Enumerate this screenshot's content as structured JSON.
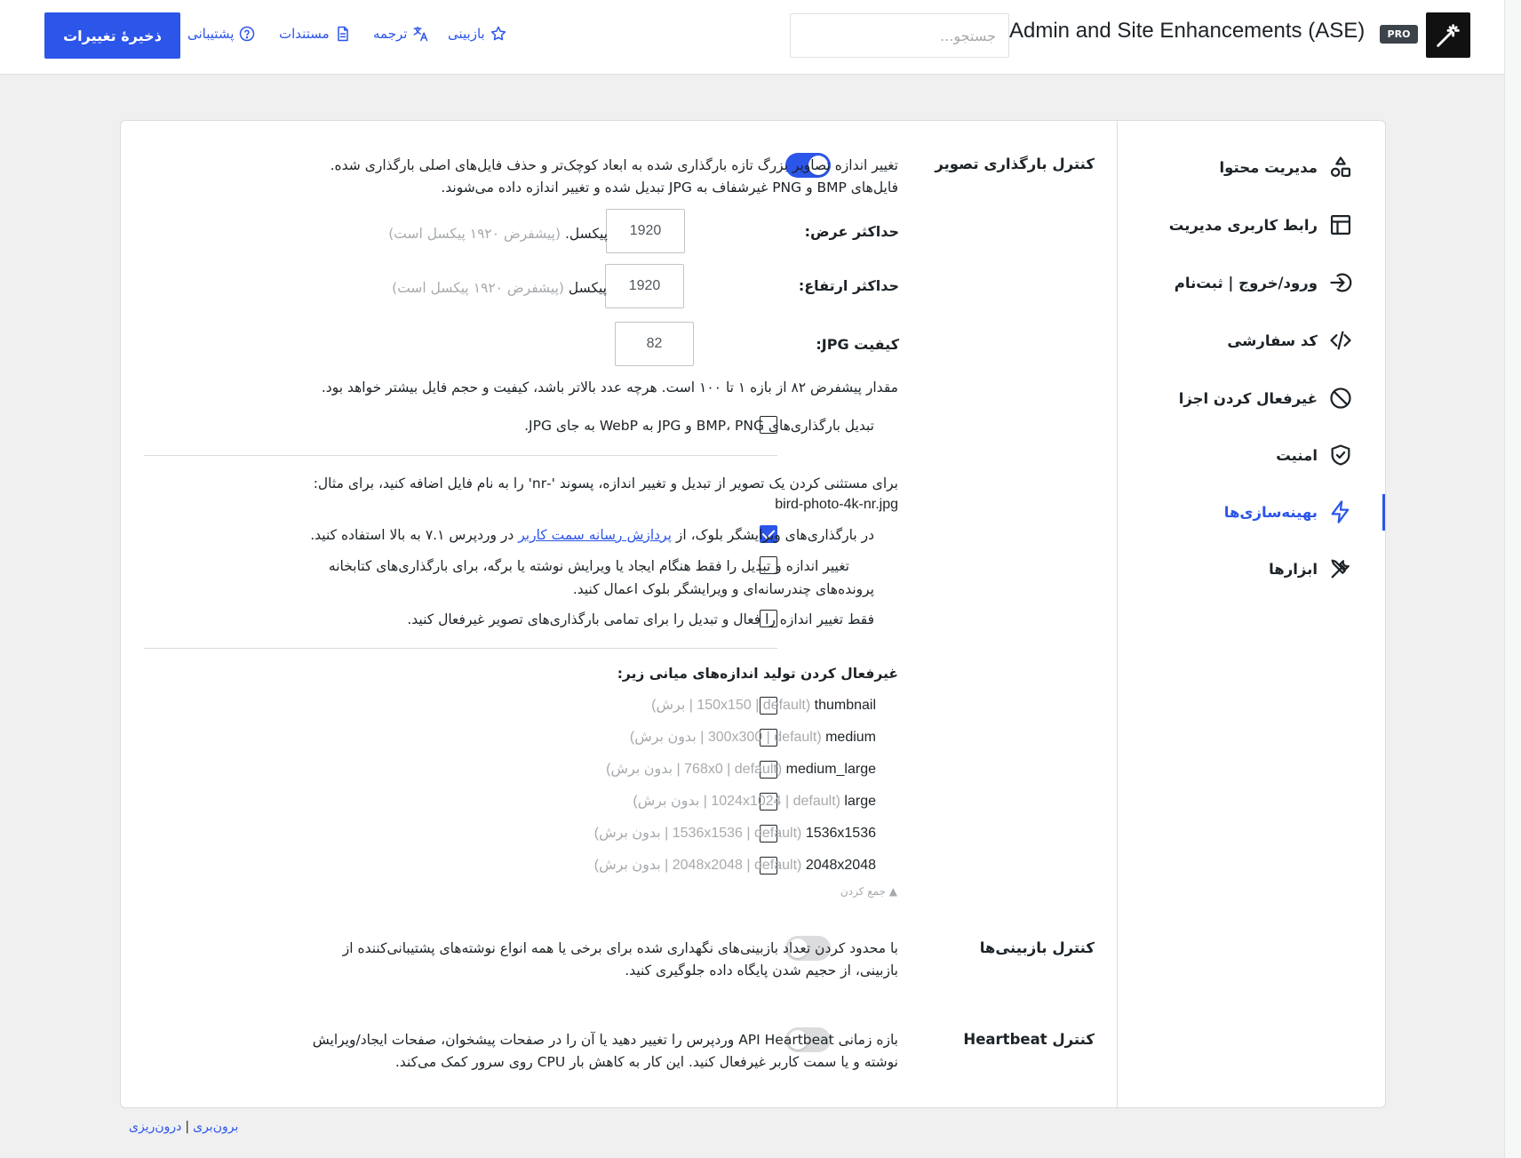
{
  "header": {
    "app_title": "Admin and Site Enhancements (ASE)",
    "pro_badge": "PRO",
    "search_placeholder": "جستجو...",
    "save_button": "ذخیرهٔ تغییرات",
    "links": [
      {
        "label": "بازبینی",
        "icon": "star-icon"
      },
      {
        "label": "ترجمه",
        "icon": "translate-icon"
      },
      {
        "label": "مستندات",
        "icon": "document-icon"
      },
      {
        "label": "پشتیبانی",
        "icon": "help-circle-icon"
      }
    ],
    "logo_icon": "magic-wand-icon"
  },
  "sidebar": {
    "items": [
      {
        "label": "مدیریت محتوا",
        "icon": "shapes-icon",
        "active": false
      },
      {
        "label": "رابط کاربری مدیریت",
        "icon": "layout-icon",
        "active": false
      },
      {
        "label": "ورود/خروج | ثبت‌نام",
        "icon": "login-icon",
        "active": false
      },
      {
        "label": "کد سفارشی",
        "icon": "code-icon",
        "active": false
      },
      {
        "label": "غیرفعال کردن اجزا",
        "icon": "ban-icon",
        "active": false
      },
      {
        "label": "امنیت",
        "icon": "shield-check-icon",
        "active": false
      },
      {
        "label": "بهینه‌سازی‌ها",
        "icon": "bolt-icon",
        "active": true
      },
      {
        "label": "ابزارها",
        "icon": "tools-icon",
        "active": false
      }
    ]
  },
  "image_upload": {
    "title": "کنترل بارگذاری تصویر",
    "enabled": true,
    "desc_line1": "تغییر اندازه تصاویر بزرگ تازه بارگذاری شده به ابعاد کوچک‌تر و حذف فایل‌های اصلی بارگذاری شده.",
    "desc_line2": "فایل‌های BMP و PNG غیرشفاف به JPG تبدیل شده و تغییر اندازه داده می‌شوند.",
    "max_width_label": "حداکثر عرض:",
    "max_width_value": "1920",
    "max_width_unit": "پیکسل.",
    "max_width_hint": "(پیشفرض ۱۹۲۰ پیکسل است)",
    "max_height_label": "حداکثر ارتفاع:",
    "max_height_value": "1920",
    "max_height_unit": "پیکسل",
    "max_height_hint": "(پیشفرض ۱۹۲۰ پیکسل است)",
    "jpg_quality_label": "کیفیت JPG:",
    "jpg_quality_value": "82",
    "jpg_quality_desc": "مقدار پیشفرض ۸۲ از بازه ۱ تا ۱۰۰ است. هرچه عدد بالاتر باشد، کیفیت و حجم فایل بیشتر خواهد بود.",
    "webp_label": "تبدیل بارگذاری‌های BMP، PNG و JPG به WebP به جای JPG.",
    "exclude_line1": "برای مستثنی کردن یک تصویر از تبدیل و تغییر اندازه، پسوند '-nr' را به نام فایل اضافه کنید، برای مثال:",
    "exclude_line2": "bird-photo-4k-nr.jpg",
    "block_editor_prefix": "در بارگذاری‌های ویرایشگر بلوک، از",
    "block_editor_link": "پردازش رسانه سمت کاربر",
    "block_editor_suffix": "در وردپرس ۷.۱ به بالا استفاده کنید.",
    "only_post_line1": "تغییر اندازه و تبدیل را فقط هنگام ایجاد یا ویرایش نوشته یا برگه، برای بارگذاری‌های کتابخانه",
    "only_post_line2": "پرونده‌های چندرسانه‌ای و ویرایشگر بلوک اعمال کنید.",
    "only_resize_label": "فقط تغییر اندازه را فعال و تبدیل را برای تمامی بارگذاری‌های تصویر غیرفعال کنید.",
    "sizes_heading": "غیرفعال کردن تولید اندازه‌های میانی زیر:",
    "sizes": [
      {
        "name": "thumbnail",
        "meta": "(150x150 | default | برش)"
      },
      {
        "name": "medium",
        "meta": "(300x300 | default | بدون برش)"
      },
      {
        "name": "medium_large",
        "meta": "(768x0 | default | بدون برش)"
      },
      {
        "name": "large",
        "meta": "(1024x1024 | default | بدون برش)"
      },
      {
        "name": "1536x1536",
        "meta": "(1536x1536 | default | بدون برش)"
      },
      {
        "name": "2048x2048",
        "meta": "(2048x2048 | default | بدون برش)"
      }
    ],
    "collapse_label": "▲ جمع کردن"
  },
  "revisions": {
    "title": "کنترل بازبینی‌ها",
    "enabled": false,
    "desc_line1": "با محدود کردن تعداد بازبینی‌های نگهداری شده برای برخی یا همه انواع نوشته‌های پشتیبانی‌کننده از",
    "desc_line2": "بازبینی، از حجیم شدن پایگاه داده جلوگیری کنید."
  },
  "heartbeat": {
    "title": "کنترل Heartbeat",
    "enabled": false,
    "desc_line1": "بازه زمانی API Heartbeat وردپرس را تغییر دهید یا آن را در صفحات پیشخوان، صفحات ایجاد/ویرایش",
    "desc_line2": "نوشته و یا سمت کاربر غیرفعال کنید. این کار به کاهش بار CPU روی سرور کمک می‌کند."
  },
  "footer": {
    "export_label": "برون‌بری",
    "import_label": "درون‌ریزی"
  },
  "colors": {
    "accent": "#2c55ea",
    "text": "#1d2327",
    "muted": "#a7aaad",
    "page_bg": "#f0f0f1"
  }
}
